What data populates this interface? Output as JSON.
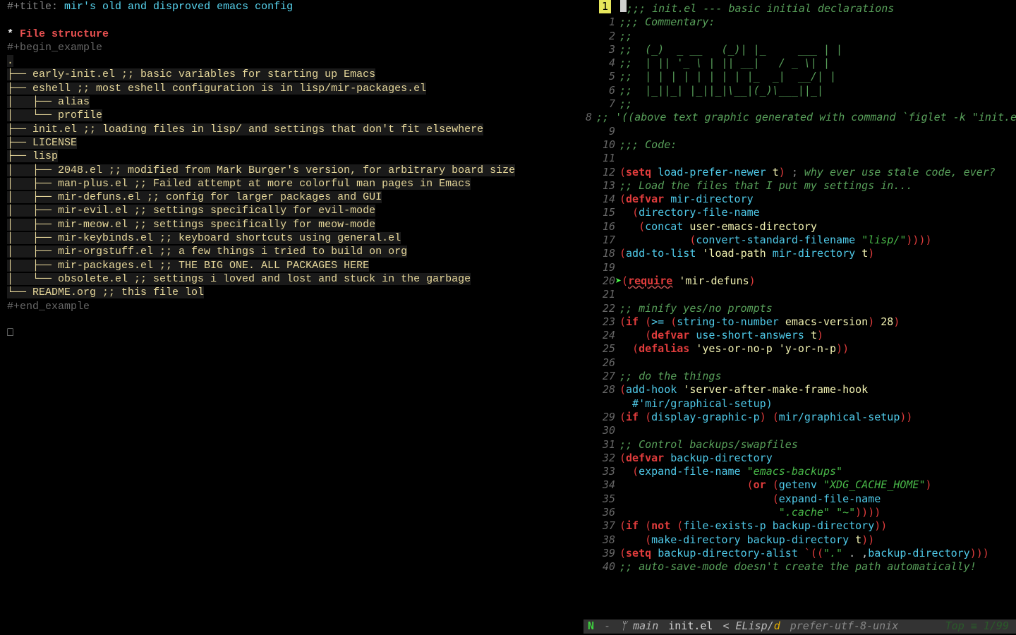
{
  "left": {
    "title_key": "#+title:",
    "title_val": "mir's old and disproved emacs config",
    "hdr_star": "* ",
    "hdr": "File structure",
    "begin": "#+begin_example",
    "dot": ".",
    "tree": [
      "├── early-init.el ;; basic variables for starting up Emacs",
      "├── eshell ;; most eshell configuration is in lisp/mir-packages.el",
      "│   ├── alias",
      "│   └── profile",
      "├── init.el ;; loading files in lisp/ and settings that don't fit elsewhere",
      "├── LICENSE",
      "├── lisp",
      "│   ├── 2048.el ;; modified from Mark Burger's version, for arbitrary board size",
      "│   ├── man-plus.el ;; Failed attempt at more colorful man pages in Emacs",
      "│   ├── mir-defuns.el ;; config for larger packages and GUI",
      "│   ├── mir-evil.el ;; settings specifically for evil-mode",
      "│   ├── mir-meow.el ;; settings specifically for meow-mode",
      "│   ├── mir-keybinds.el ;; keyboard shortcuts using general.el",
      "│   ├── mir-orgstuff.el ;; a few things i tried to build on org",
      "│   ├── mir-packages.el ;; THE BIG ONE. ALL PACKAGES HERE",
      "│   └── obsolete.el ;; settings i loved and lost and stuck in the garbage",
      "└── README.org ;; this file lol"
    ],
    "end": "#+end_example",
    "cursor_box": "⎕"
  },
  "right": {
    "tag": "1",
    "lines": [
      {
        "n": "",
        "kind": "first",
        "html": ";;; init.el --- basic initial declarations",
        "class": "comment"
      },
      {
        "n": "1",
        "text": ";;; Commentary:",
        "class": "comment"
      },
      {
        "n": "2",
        "text": ";;",
        "class": "comment"
      },
      {
        "n": "3",
        "text": ";;  (_)  _ __   (_)| |_     ___ | |",
        "class": "comment"
      },
      {
        "n": "4",
        "text": ";;  | || '_ \\ | || __|   / _ \\| |",
        "class": "comment"
      },
      {
        "n": "5",
        "text": ";;  | | | | | | | | |_  _|  __/| |",
        "class": "comment"
      },
      {
        "n": "6",
        "text": ";;  |_||_| |_||_|\\__|(_)\\___||_|",
        "class": "comment"
      },
      {
        "n": "7",
        "text": ";;",
        "class": "comment"
      },
      {
        "n": "8",
        "text": ";; '((above text graphic generated with command `figlet -k \"init.el\"'))",
        "class": "comment",
        "wrap": true
      },
      {
        "n": "9",
        "text": "",
        "class": ""
      },
      {
        "n": "10",
        "text": ";;; Code:",
        "class": "comment"
      },
      {
        "n": "11",
        "text": "",
        "class": ""
      },
      {
        "n": "12",
        "segs": [
          [
            "paren",
            "("
          ],
          [
            "keyword",
            "setq "
          ],
          [
            "var",
            "load-prefer-newer "
          ],
          [
            "const",
            "t"
          ],
          [
            "paren",
            ")"
          ],
          [
            "dim",
            " ; "
          ],
          [
            "comment",
            "why ever use stale code, ever?"
          ]
        ]
      },
      {
        "n": "13",
        "text": ";; Load the files that I put my settings in...",
        "class": "comment"
      },
      {
        "n": "14",
        "segs": [
          [
            "paren",
            "("
          ],
          [
            "keyword",
            "defvar "
          ],
          [
            "var",
            "mir-directory"
          ]
        ]
      },
      {
        "n": "15",
        "segs": [
          [
            "",
            "  "
          ],
          [
            "paren",
            "("
          ],
          [
            "var",
            "directory-file-name"
          ]
        ]
      },
      {
        "n": "16",
        "segs": [
          [
            "",
            "   "
          ],
          [
            "paren",
            "("
          ],
          [
            "var",
            "concat "
          ],
          [
            "const",
            "user-emacs-directory"
          ]
        ]
      },
      {
        "n": "17",
        "segs": [
          [
            "",
            "           "
          ],
          [
            "paren",
            "("
          ],
          [
            "var",
            "convert-standard-filename "
          ],
          [
            "string",
            "\"lisp/\""
          ],
          [
            "paren",
            "))))"
          ]
        ]
      },
      {
        "n": "18",
        "segs": [
          [
            "paren",
            "("
          ],
          [
            "var",
            "add-to-list "
          ],
          [
            "const",
            "'load-path "
          ],
          [
            "var",
            "mir-directory "
          ],
          [
            "const",
            "t"
          ],
          [
            "paren",
            ")"
          ]
        ]
      },
      {
        "n": "19",
        "text": "",
        "class": ""
      },
      {
        "n": "20",
        "arrow": true,
        "segs": [
          [
            "paren",
            "("
          ],
          [
            "err",
            "require"
          ],
          [
            "",
            " "
          ],
          [
            "const",
            "'mir-defuns"
          ],
          [
            "paren",
            ")"
          ]
        ]
      },
      {
        "n": "21",
        "text": "",
        "class": ""
      },
      {
        "n": "22",
        "text": ";; minify yes/no prompts",
        "class": "comment"
      },
      {
        "n": "23",
        "segs": [
          [
            "paren",
            "("
          ],
          [
            "keyword",
            "if "
          ],
          [
            "paren",
            "("
          ],
          [
            "var",
            ">= "
          ],
          [
            "paren",
            "("
          ],
          [
            "var",
            "string-to-number "
          ],
          [
            "const",
            "emacs-version"
          ],
          [
            "paren",
            ") "
          ],
          [
            "const",
            "28"
          ],
          [
            "paren",
            ")"
          ]
        ]
      },
      {
        "n": "24",
        "segs": [
          [
            "",
            "    "
          ],
          [
            "paren",
            "("
          ],
          [
            "keyword",
            "defvar "
          ],
          [
            "var",
            "use-short-answers "
          ],
          [
            "const",
            "t"
          ],
          [
            "paren",
            ")"
          ]
        ]
      },
      {
        "n": "25",
        "segs": [
          [
            "",
            "  "
          ],
          [
            "paren",
            "("
          ],
          [
            "keyword",
            "defalias "
          ],
          [
            "const",
            "'yes-or-no-p "
          ],
          [
            "const",
            "'y-or-n-p"
          ],
          [
            "paren",
            "))"
          ]
        ]
      },
      {
        "n": "26",
        "text": "",
        "class": ""
      },
      {
        "n": "27",
        "text": ";; do the things",
        "class": "comment"
      },
      {
        "n": "28",
        "segs": [
          [
            "paren",
            "("
          ],
          [
            "var",
            "add-hook "
          ],
          [
            "const",
            "'server-after-make-frame-hook"
          ]
        ],
        "cont": "  #'mir/graphical-setup)"
      },
      {
        "n": "29",
        "segs": [
          [
            "paren",
            "("
          ],
          [
            "keyword",
            "if "
          ],
          [
            "paren",
            "("
          ],
          [
            "var",
            "display-graphic-p"
          ],
          [
            "paren",
            ") ("
          ],
          [
            "var",
            "mir/graphical-setup"
          ],
          [
            "paren",
            "))"
          ]
        ]
      },
      {
        "n": "30",
        "text": "",
        "class": ""
      },
      {
        "n": "31",
        "text": ";; Control backups/swapfiles",
        "class": "comment"
      },
      {
        "n": "32",
        "segs": [
          [
            "paren",
            "("
          ],
          [
            "keyword",
            "defvar "
          ],
          [
            "var",
            "backup-directory"
          ]
        ]
      },
      {
        "n": "33",
        "segs": [
          [
            "",
            "  "
          ],
          [
            "paren",
            "("
          ],
          [
            "var",
            "expand-file-name "
          ],
          [
            "string",
            "\"emacs-backups\""
          ]
        ]
      },
      {
        "n": "34",
        "segs": [
          [
            "",
            "                    "
          ],
          [
            "paren",
            "("
          ],
          [
            "keyword",
            "or "
          ],
          [
            "paren",
            "("
          ],
          [
            "var",
            "getenv "
          ],
          [
            "string",
            "\"XDG_CACHE_HOME\""
          ],
          [
            "paren",
            ")"
          ]
        ]
      },
      {
        "n": "35",
        "segs": [
          [
            "",
            "                        "
          ],
          [
            "paren",
            "("
          ],
          [
            "var",
            "expand-file-name"
          ]
        ]
      },
      {
        "n": "36",
        "segs": [
          [
            "",
            "                         "
          ],
          [
            "string",
            "\".cache\" "
          ],
          [
            "string",
            "\"~\""
          ],
          [
            "paren",
            "))))"
          ]
        ]
      },
      {
        "n": "37",
        "segs": [
          [
            "paren",
            "("
          ],
          [
            "keyword",
            "if "
          ],
          [
            "paren",
            "("
          ],
          [
            "keyword",
            "not "
          ],
          [
            "paren",
            "("
          ],
          [
            "var",
            "file-exists-p "
          ],
          [
            "var",
            "backup-directory"
          ],
          [
            "paren",
            "))"
          ]
        ]
      },
      {
        "n": "38",
        "segs": [
          [
            "",
            "    "
          ],
          [
            "paren",
            "("
          ],
          [
            "var",
            "make-directory "
          ],
          [
            "var",
            "backup-directory "
          ],
          [
            "const",
            "t"
          ],
          [
            "paren",
            "))"
          ]
        ]
      },
      {
        "n": "39",
        "segs": [
          [
            "paren",
            "("
          ],
          [
            "keyword",
            "setq "
          ],
          [
            "var",
            "backup-directory-alist "
          ],
          [
            "paren",
            "`(("
          ],
          [
            "string",
            "\".\""
          ],
          [
            "",
            " . ,"
          ],
          [
            "var",
            "backup-directory"
          ],
          [
            "paren",
            ")))"
          ]
        ]
      },
      {
        "n": "40",
        "text": ";; auto-save-mode doesn't create the path automatically!",
        "class": "comment"
      }
    ]
  },
  "modeline": {
    "mode": "N",
    "sep1": "-",
    "branch_icon": "ᛘ",
    "branch": "main",
    "file": "init.el",
    "lang_open": "< ",
    "lang": "ELisp/",
    "lang_flag": "d",
    "encoding": "prefer-utf-8-unix",
    "pos": "Top ≡ 1/99"
  }
}
